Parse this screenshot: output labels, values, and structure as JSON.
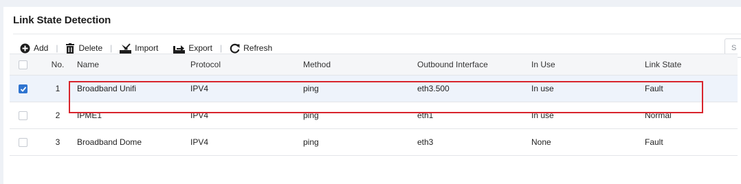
{
  "page": {
    "title": "Link State Detection"
  },
  "toolbar": {
    "add": "Add",
    "delete": "Delete",
    "import": "Import",
    "export": "Export",
    "refresh": "Refresh",
    "separator": "|"
  },
  "search": {
    "placeholder": "S"
  },
  "table": {
    "headers": {
      "no": "No.",
      "name": "Name",
      "protocol": "Protocol",
      "method": "Method",
      "outbound": "Outbound Interface",
      "in_use": "In Use",
      "link_state": "Link State"
    },
    "rows": [
      {
        "checked": true,
        "no": "1",
        "name": "Broadband Unifi",
        "protocol": "IPV4",
        "method": "ping",
        "outbound": "eth3.500",
        "in_use": "In use",
        "link_state": "Fault"
      },
      {
        "checked": false,
        "no": "2",
        "name": "IPME1",
        "protocol": "IPV4",
        "method": "ping",
        "outbound": "eth1",
        "in_use": "In use",
        "link_state": "Normal"
      },
      {
        "checked": false,
        "no": "3",
        "name": "Broadband Dome",
        "protocol": "IPV4",
        "method": "ping",
        "outbound": "eth3",
        "in_use": "None",
        "link_state": "Fault"
      }
    ]
  },
  "colors": {
    "link": "#2f74d0",
    "fault": "#e4393c",
    "highlight": "#d8242c",
    "selected_row": "#eef3fb"
  },
  "icons": {
    "add": "plus-circle-icon",
    "delete": "trash-icon",
    "import": "import-icon",
    "export": "export-icon",
    "refresh": "refresh-icon"
  }
}
